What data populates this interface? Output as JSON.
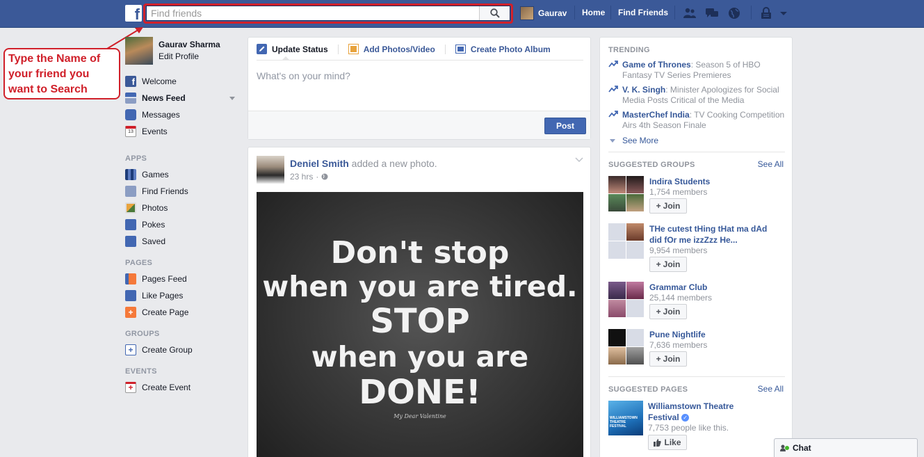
{
  "topbar": {
    "logo": "f",
    "search_placeholder": "Find friends",
    "user_name": "Gaurav",
    "home": "Home",
    "find_friends": "Find Friends"
  },
  "annotation": {
    "text_line1": "Type the Name of",
    "text_line2": "your friend you",
    "text_line3": "want to Search",
    "color": "#d0202a"
  },
  "left_nav": {
    "profile_name": "Gaurav Sharma",
    "edit_profile": "Edit Profile",
    "items": [
      {
        "label": "Welcome",
        "icon": "facebook-icon"
      },
      {
        "label": "News Feed",
        "icon": "news-feed-icon"
      },
      {
        "label": "Messages",
        "icon": "messages-icon"
      },
      {
        "label": "Events",
        "icon": "calendar-icon",
        "badge": "13"
      }
    ],
    "apps_header": "APPS",
    "apps": [
      {
        "label": "Games",
        "icon": "games-icon"
      },
      {
        "label": "Find Friends",
        "icon": "find-friends-icon"
      },
      {
        "label": "Photos",
        "icon": "photos-icon"
      },
      {
        "label": "Pokes",
        "icon": "pokes-icon"
      },
      {
        "label": "Saved",
        "icon": "bookmark-icon"
      }
    ],
    "pages_header": "PAGES",
    "pages": [
      {
        "label": "Pages Feed",
        "icon": "flag-icon"
      },
      {
        "label": "Like Pages",
        "icon": "like-icon"
      },
      {
        "label": "Create Page",
        "icon": "plus-icon"
      }
    ],
    "groups_header": "GROUPS",
    "groups": [
      {
        "label": "Create Group",
        "icon": "plus-icon"
      }
    ],
    "events_header": "EVENTS",
    "events": [
      {
        "label": "Create Event",
        "icon": "plus-icon"
      }
    ]
  },
  "composer": {
    "tab_status": "Update Status",
    "tab_photos": "Add Photos/Video",
    "tab_album": "Create Photo Album",
    "placeholder": "What's on your mind?",
    "post_label": "Post"
  },
  "story": {
    "author": "Deniel Smith",
    "action": " added a new photo.",
    "time": "23 hrs",
    "photo_lines": [
      "Don't stop",
      "when you are tired.",
      "STOP",
      "when you are",
      "DONE!"
    ],
    "photo_signature": "My Dear Valentine"
  },
  "right": {
    "trending_header": "TRENDING",
    "trends": [
      {
        "topic": "Game of Thrones",
        "text": ": Season 5 of HBO Fantasy TV Series Premieres"
      },
      {
        "topic": "V. K. Singh",
        "text": ": Minister Apologizes for Social Media Posts Critical of the Media"
      },
      {
        "topic": "MasterChef India",
        "text": ": TV Cooking Competition Airs 4th Season Finale"
      }
    ],
    "see_more": "See More",
    "groups_header": "SUGGESTED GROUPS",
    "see_all": "See All",
    "groups": [
      {
        "name": "Indira Students",
        "members": "1,754 members",
        "join": "Join"
      },
      {
        "name": "THe cutest tHing tHat ma dAd did fOr me izzZzz He...",
        "members": "9,954 members",
        "join": "Join"
      },
      {
        "name": "Grammar Club",
        "members": "25,144 members",
        "join": "Join"
      },
      {
        "name": "Pune Nightlife",
        "members": "7,636 members",
        "join": "Join"
      }
    ],
    "pages_header": "SUGGESTED PAGES",
    "page": {
      "name": "Williamstown Theatre Festival",
      "likes": "7,753 people like this.",
      "like_label": "Like",
      "thumb_text": "WILLIAMSTOWN THEATRE FESTIVAL"
    }
  },
  "chat": {
    "label": "Chat"
  }
}
